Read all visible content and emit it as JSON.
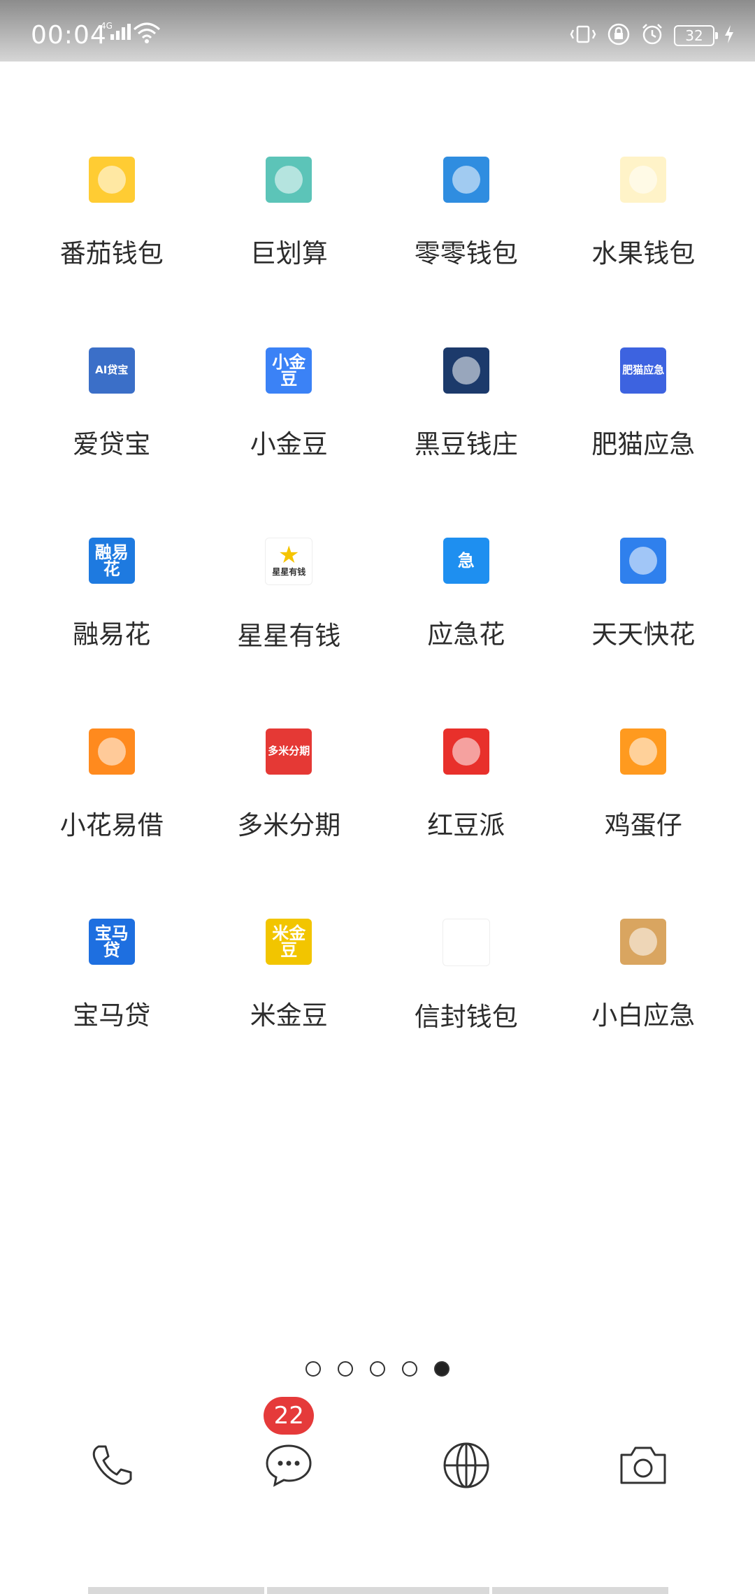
{
  "status_bar": {
    "time": "00:04",
    "network": "4G",
    "battery": "32"
  },
  "apps": [
    {
      "label": "番茄钱包",
      "icon": "tomato-icon",
      "color": "#ffcc33"
    },
    {
      "label": "巨划算",
      "icon": "ju-character-icon",
      "color": "#5cc4b8"
    },
    {
      "label": "零零钱包",
      "icon": "blue-shield-logo-icon",
      "color": "#2f8de0"
    },
    {
      "label": "水果钱包",
      "icon": "watermelon-icon",
      "color": "#fff3c8"
    },
    {
      "label": "爱贷宝",
      "icon": "ai-loan-icon",
      "color": "#3b6fc8",
      "text": "AI贷宝"
    },
    {
      "label": "小金豆",
      "icon": "golden-bean-character-icon",
      "color": "#3b82f6",
      "text": "小金豆"
    },
    {
      "label": "黑豆钱庄",
      "icon": "black-bean-character-icon",
      "color": "#1c3a6b"
    },
    {
      "label": "肥猫应急",
      "icon": "fat-cat-icon",
      "color": "#3d63e0",
      "text": "肥猫应急"
    },
    {
      "label": "融易花",
      "icon": "rongyihua-icon",
      "color": "#1e7ae0",
      "text": "融易花"
    },
    {
      "label": "星星有钱",
      "icon": "star-icon",
      "color": "#ffffff",
      "text": "星星有钱"
    },
    {
      "label": "应急花",
      "icon": "ji-character-icon",
      "color": "#1e8ff0",
      "text": "急"
    },
    {
      "label": "天天快花",
      "icon": "cat-mascot-icon",
      "color": "#2f80ed"
    },
    {
      "label": "小花易借",
      "icon": "flower-icon",
      "color": "#ff8a1e"
    },
    {
      "label": "多米分期",
      "icon": "duomi-installment-icon",
      "color": "#e53935",
      "text": "多米分期"
    },
    {
      "label": "红豆派",
      "icon": "red-bean-icon",
      "color": "#e8302b"
    },
    {
      "label": "鸡蛋仔",
      "icon": "egg-icon",
      "color": "#ff9a1f"
    },
    {
      "label": "宝马贷",
      "icon": "horse-icon",
      "color": "#1e6fe0",
      "text": "宝马贷"
    },
    {
      "label": "米金豆",
      "icon": "gold-beans-icon",
      "color": "#f2c500",
      "text": "米金豆"
    },
    {
      "label": "信封钱包",
      "icon": "envelope-icon",
      "color": "#ffffff"
    },
    {
      "label": "小白应急",
      "icon": "b-logo-icon",
      "color": "#d9a560"
    }
  ],
  "page_indicator": {
    "count": 5,
    "active": 5
  },
  "dock": [
    {
      "name": "phone",
      "icon": "phone-icon"
    },
    {
      "name": "messages",
      "icon": "chat-bubble-icon",
      "badge": "22"
    },
    {
      "name": "browser",
      "icon": "globe-icon"
    },
    {
      "name": "camera",
      "icon": "camera-icon"
    }
  ]
}
